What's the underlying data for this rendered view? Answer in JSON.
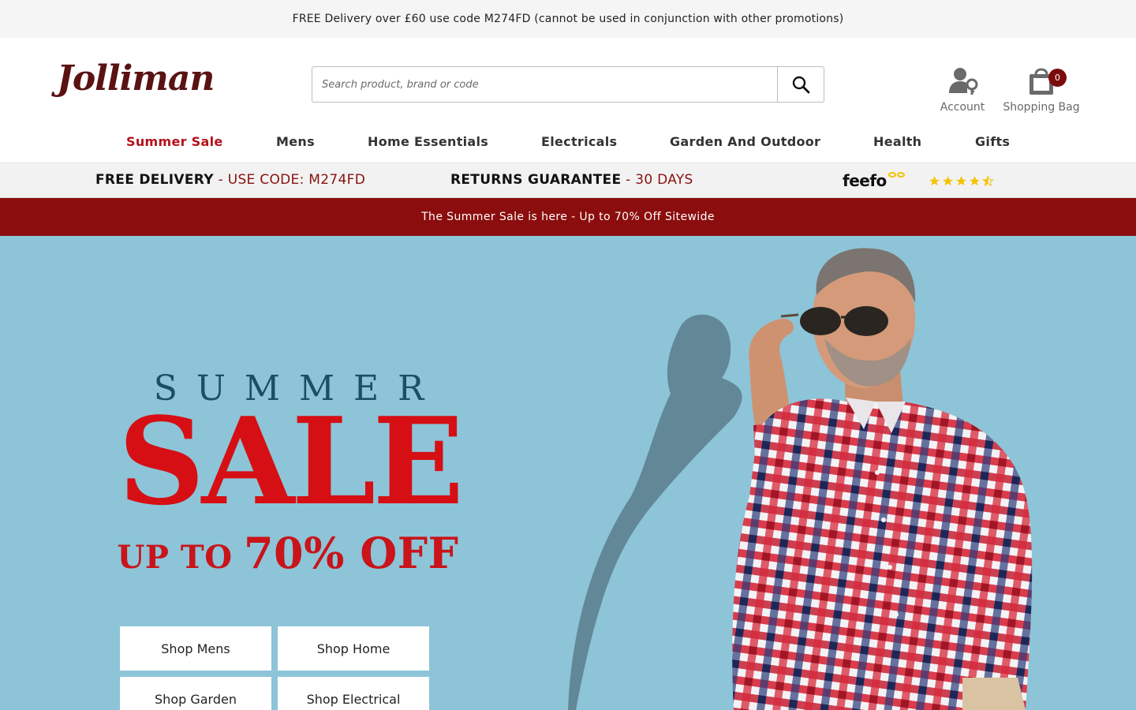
{
  "promo_bar": {
    "text": "FREE Delivery over £60 use code M274FD (cannot be used in conjunction with other promotions)"
  },
  "header": {
    "logo": "Jolliman",
    "search": {
      "placeholder": "Search product, brand or code",
      "value": ""
    },
    "account_label": "Account",
    "bag_label": "Shopping Bag",
    "bag_count": "0"
  },
  "nav": {
    "items": [
      {
        "label": "Summer Sale"
      },
      {
        "label": "Mens"
      },
      {
        "label": "Home Essentials"
      },
      {
        "label": "Electricals"
      },
      {
        "label": "Garden And Outdoor"
      },
      {
        "label": "Health"
      },
      {
        "label": "Gifts"
      }
    ]
  },
  "usp": {
    "delivery_bold": "FREE DELIVERY",
    "delivery_rest": " - USE CODE: M274FD",
    "returns_bold": "RETURNS GUARANTEE",
    "returns_rest": " - 30 DAYS",
    "feefo_logo": "feefo",
    "rating_stars": 4.5
  },
  "sale_banner": {
    "text": "The Summer Sale is here - Up to 70% Off Sitewide"
  },
  "hero": {
    "line1": "SUMMER",
    "line2": "SALE",
    "line3_prefix": "UP TO ",
    "line3_emph": "70% OFF",
    "buttons": [
      {
        "label": "Shop Mens"
      },
      {
        "label": "Shop Home"
      },
      {
        "label": "Shop Garden"
      },
      {
        "label": "Shop Electrical"
      }
    ]
  },
  "colors": {
    "brand": "#5a1212",
    "accent_red": "#8b0d0d",
    "sale_red": "#d60f14",
    "hero_bg": "#8dc4d8"
  }
}
